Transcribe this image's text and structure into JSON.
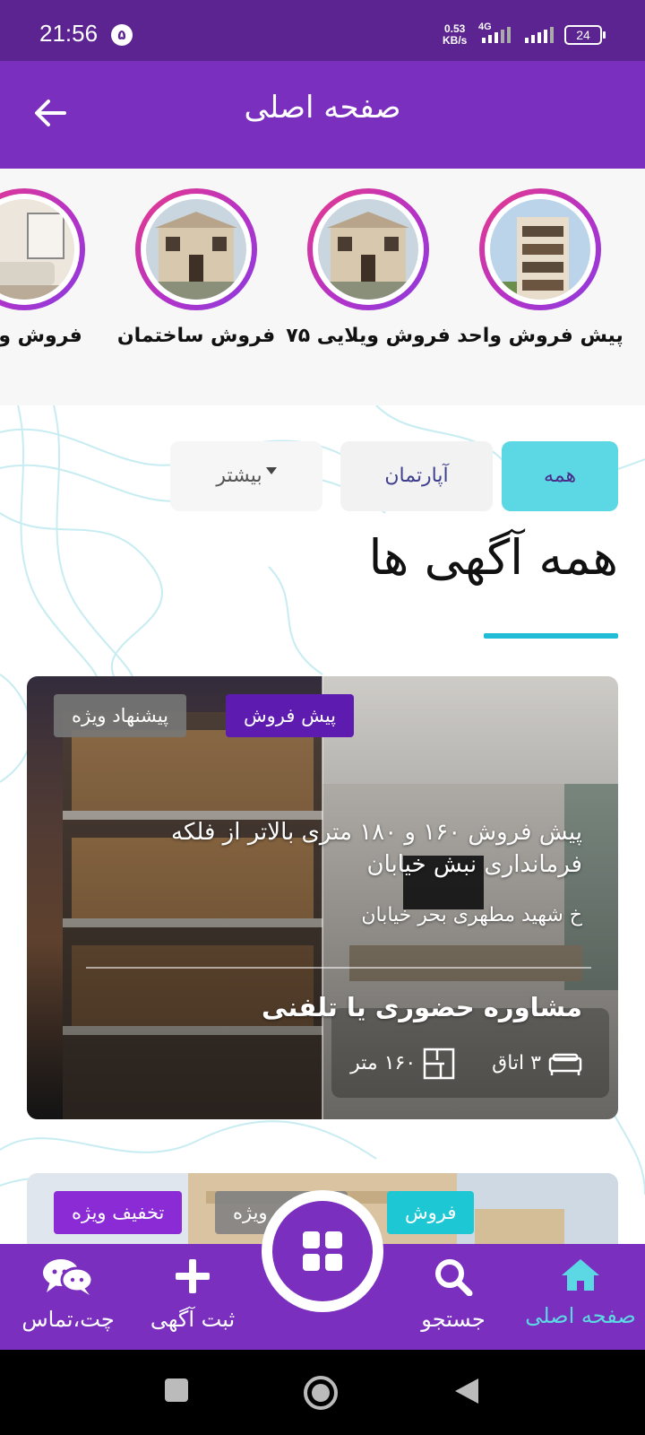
{
  "status_bar": {
    "time": "21:56",
    "notification_count": "۵",
    "speed_value": "0.53",
    "speed_unit": "KB/s",
    "network": "4G",
    "battery": "24"
  },
  "app_bar": {
    "title": "صفحه اصلی",
    "back_icon": "arrow-left-icon"
  },
  "stories": [
    {
      "label": "پیش فروش واحد"
    },
    {
      "label": "فروش ویلایی ۷۵"
    },
    {
      "label": "فروش ساختمان"
    },
    {
      "label": "فروش واحد"
    }
  ],
  "tabs": {
    "all": "همه",
    "apartment": "آپارتمان",
    "more": "بیشتر"
  },
  "section": {
    "title": "همه آگهی ها"
  },
  "listings": [
    {
      "badges": [
        "پیش فروش",
        "پیشنهاد ویژه"
      ],
      "title": "پیش فروش ۱۶۰ و ۱۸۰ متری بالاتر از فلکه فرمانداری نبش خیابان",
      "address": "خ شهید مطهری بحر خیابان",
      "consult": "مشاوره حضوری یا تلفنی",
      "rooms": "۳ اتاق",
      "area": "۱۶۰ متر"
    },
    {
      "badges": [
        "فروش",
        "پیشنهاد ویژه",
        "تخفیف ویژه"
      ]
    }
  ],
  "bottom_nav": {
    "home": "صفحه اصلی",
    "search": "جستجو",
    "add": "ثبت آگهی",
    "chat": "چت،تماس"
  },
  "colors": {
    "primary": "#7b2fbe",
    "status_bar": "#5c2490",
    "accent": "#5bd8e3",
    "underline": "#21bcd6",
    "presale_badge": "#5d1bb0",
    "discount_badge": "#8b2bd6"
  }
}
